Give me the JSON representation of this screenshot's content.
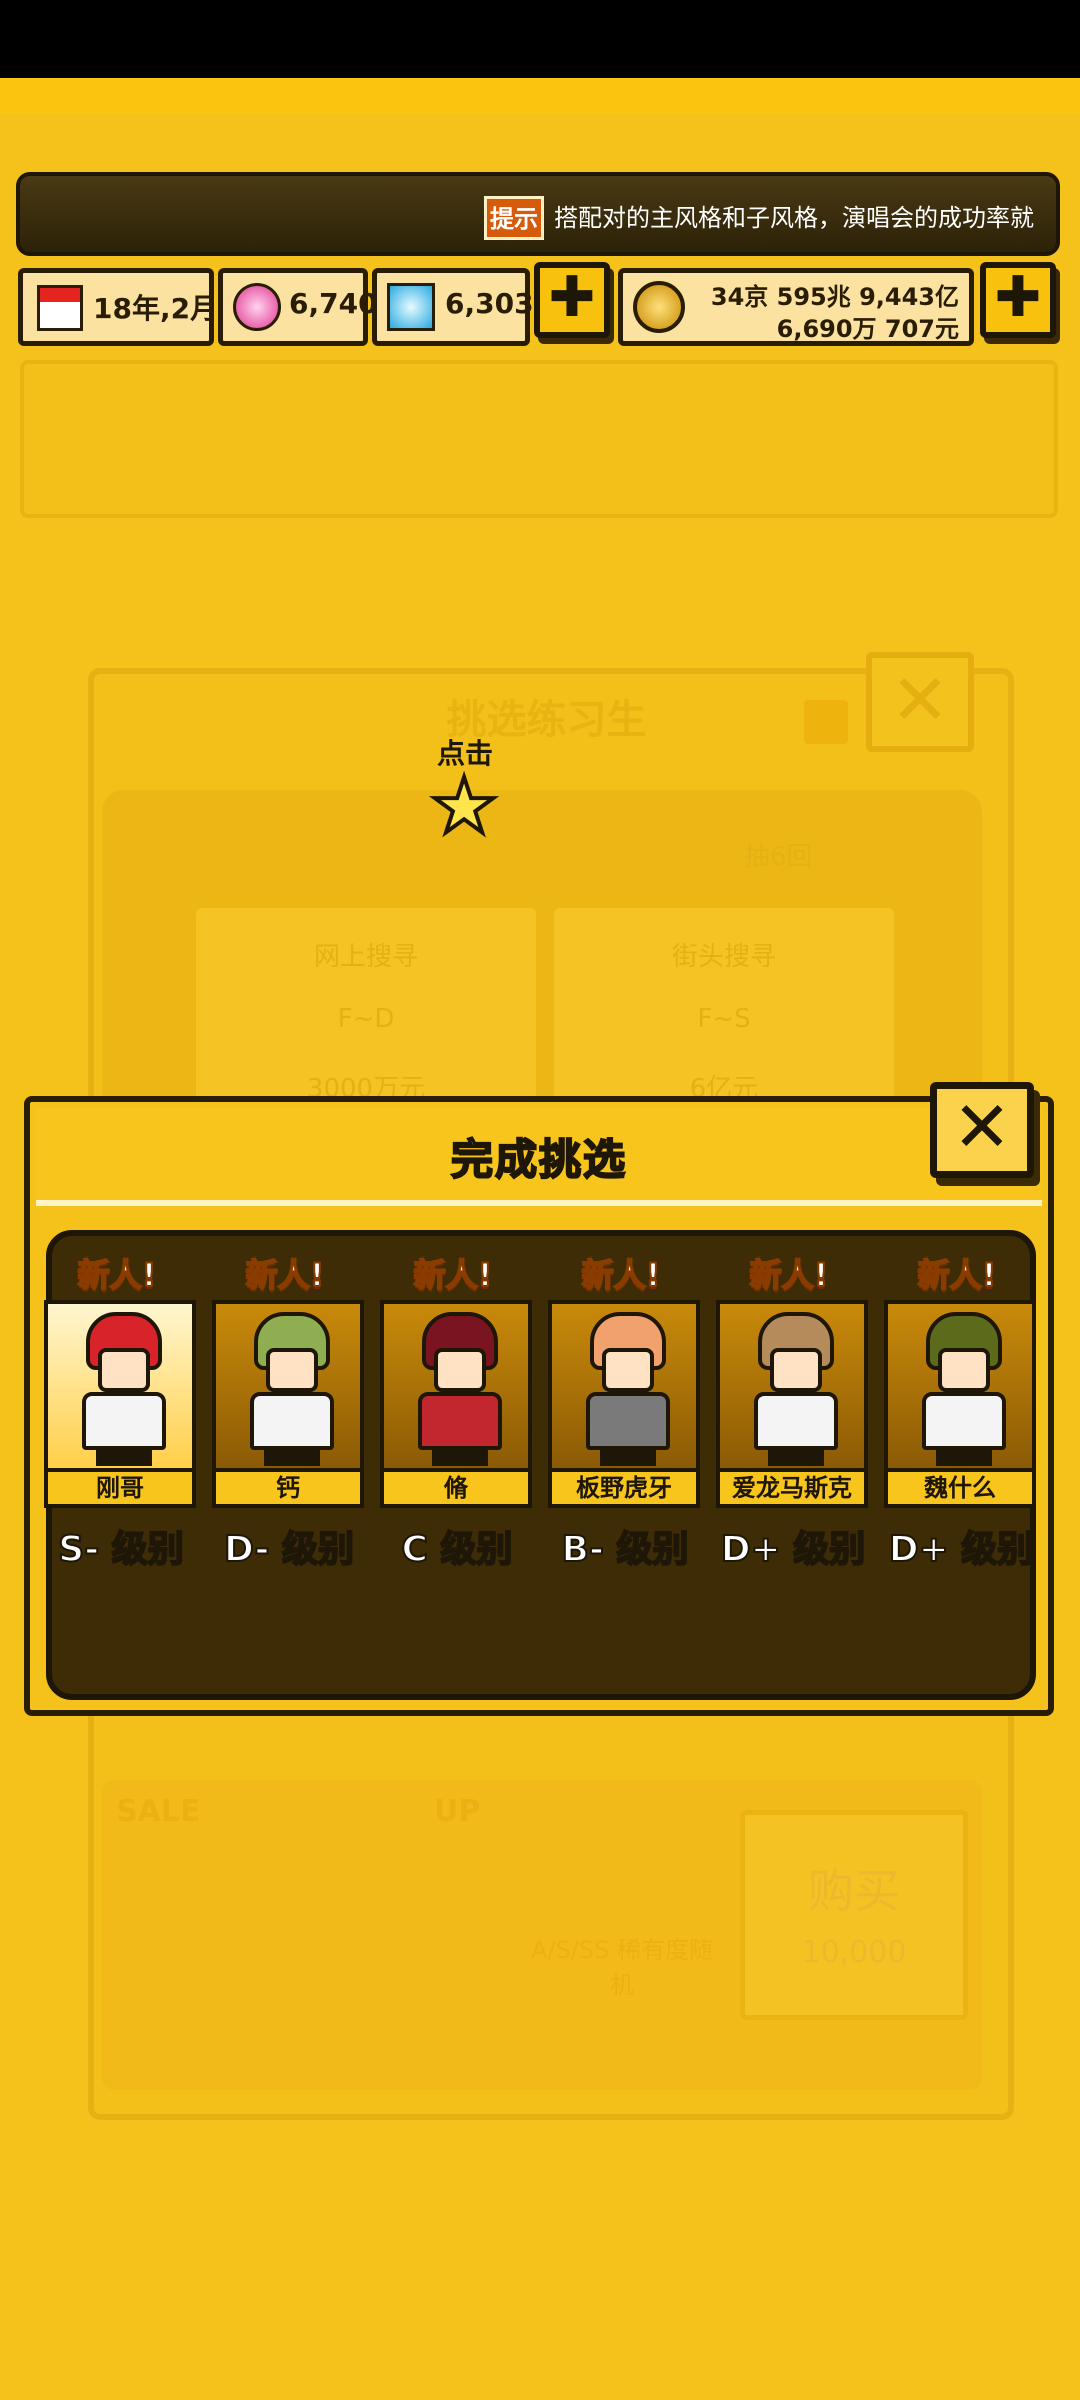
{
  "tip": {
    "icon_label": "提示",
    "text": "搭配对的主风格和子风格，演唱会的成功率就"
  },
  "hud": {
    "date": "18年,2月",
    "pink_gems": "6,740",
    "blue_gems": "6,303",
    "money_line1": "34京 595兆 9,443亿",
    "money_line2": "6,690万 707元",
    "plus_symbol": "✚"
  },
  "background_menu": {
    "title": "挑选练习生",
    "draws": "抽6回",
    "card_left_title": "网上搜寻",
    "card_left_range": "F~D",
    "card_left_price": "3000万元",
    "card_right_title": "街头搜寻",
    "card_right_range": "F~S",
    "card_right_price": "6亿元",
    "sale": "SALE",
    "up": "UP",
    "rare": "A/S/SS 稀有度随机",
    "buy": "购买",
    "buy_price": "10,000"
  },
  "tap_hint": "点击",
  "modal": {
    "title": "完成挑选",
    "close_symbol": "✕",
    "characters": [
      {
        "badge": "新人!",
        "name": "刚哥",
        "grade": "S- 级别",
        "hair": "#d8232a",
        "outfit": "#f4f4f4",
        "highlight": true
      },
      {
        "badge": "新人!",
        "name": "钙",
        "grade": "D- 级别",
        "hair": "#8fae52",
        "outfit": "#f4f4f4",
        "highlight": false
      },
      {
        "badge": "新人!",
        "name": "脩",
        "grade": "C 级别",
        "hair": "#7a1420",
        "outfit": "#c2262e",
        "highlight": false
      },
      {
        "badge": "新人!",
        "name": "板野虎牙",
        "grade": "B- 级别",
        "hair": "#f0a16e",
        "outfit": "#7a7a7a",
        "highlight": false
      },
      {
        "badge": "新人!",
        "name": "爱龙马斯克",
        "grade": "D+ 级别",
        "hair": "#b58b5b",
        "outfit": "#f4f4f4",
        "highlight": false
      },
      {
        "badge": "新人!",
        "name": "魏什么",
        "grade": "D+ 级别",
        "hair": "#5c6a1c",
        "outfit": "#f4f4f4",
        "highlight": false
      }
    ]
  }
}
